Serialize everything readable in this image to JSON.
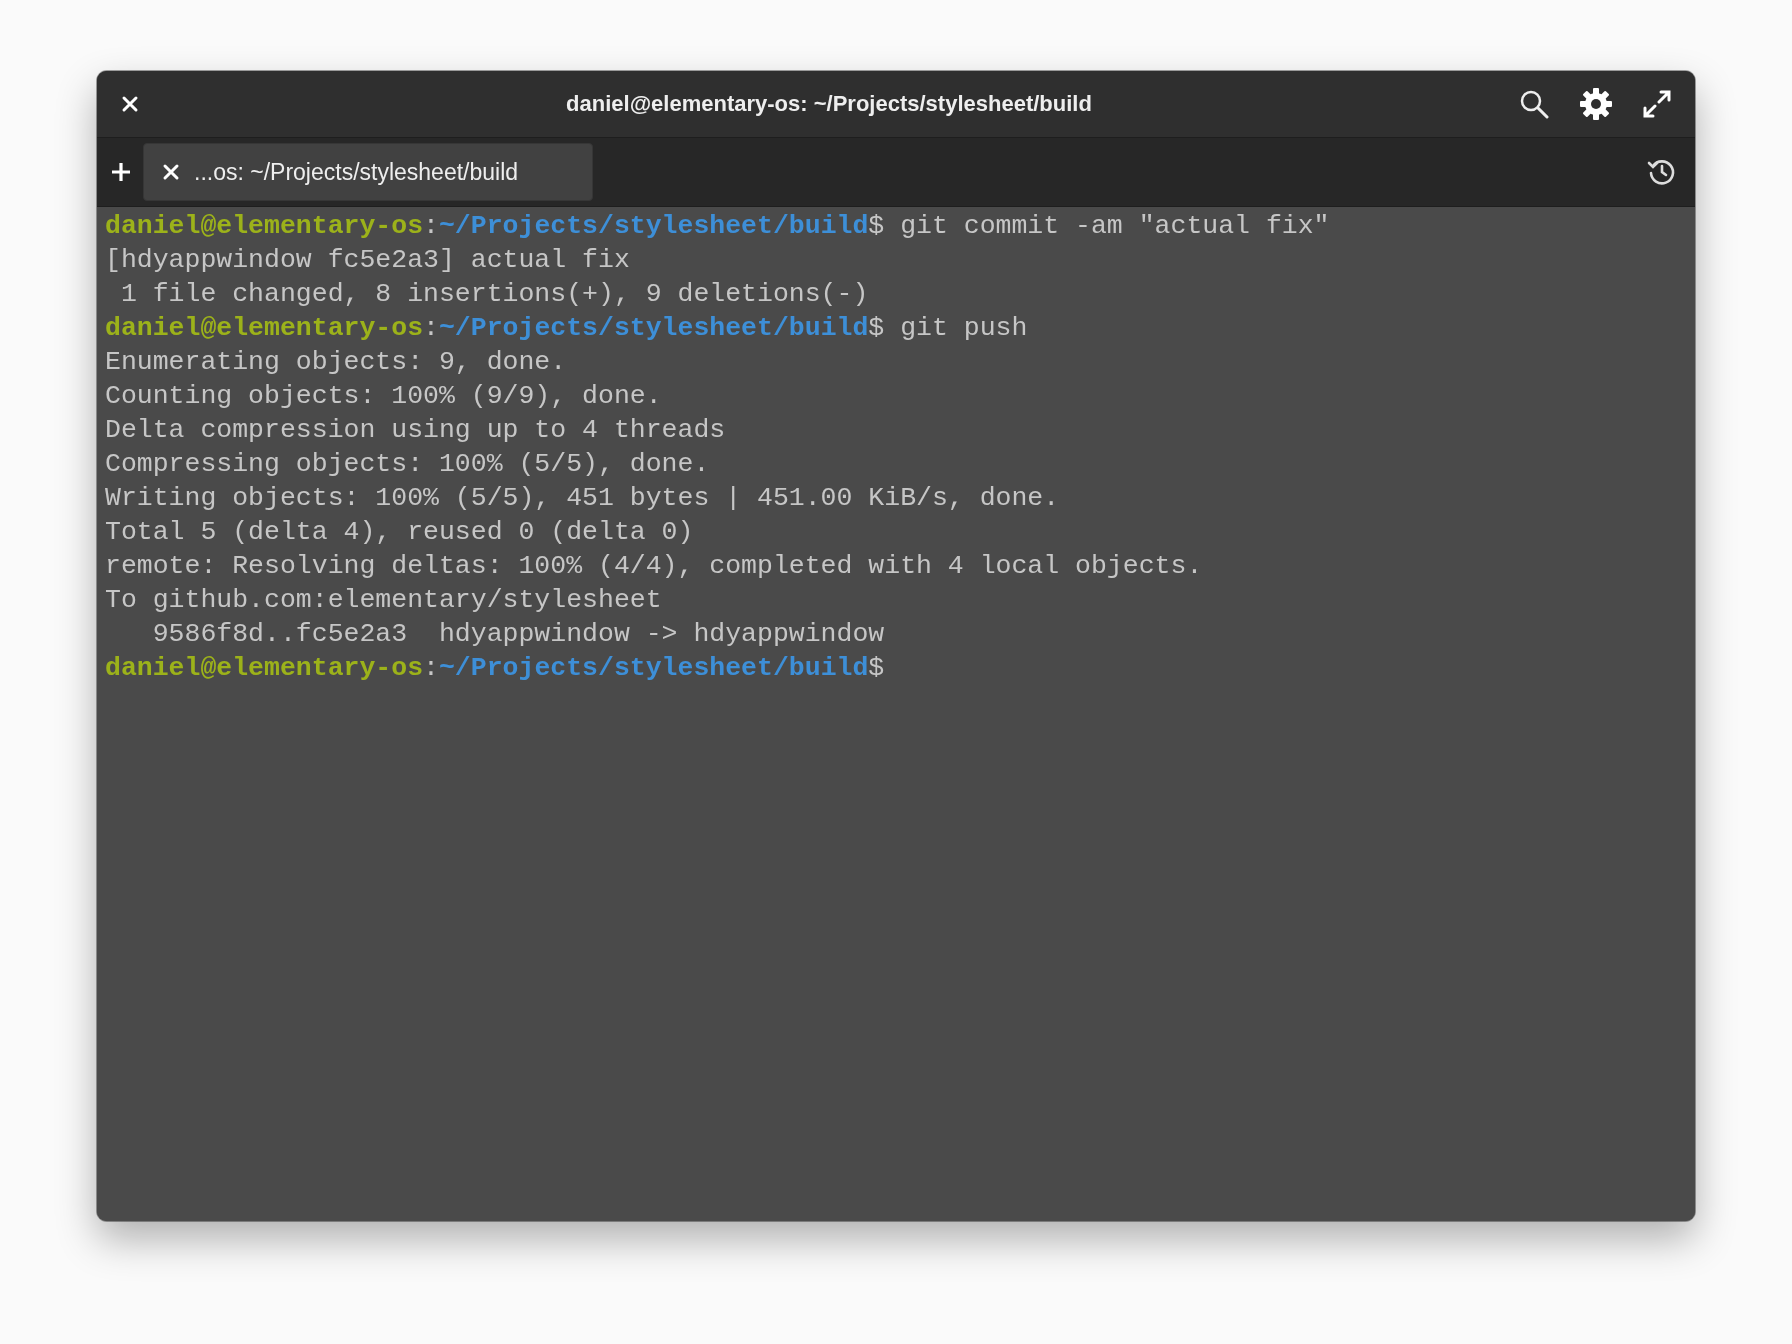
{
  "window": {
    "title": "daniel@elementary-os: ~/Projects/stylesheet/build"
  },
  "tabs": [
    {
      "label": "...os: ~/Projects/stylesheet/build",
      "selected": true
    }
  ],
  "terminal": {
    "lines": [
      {
        "kind": "prompt",
        "user": "daniel@elementary-os",
        "separator": ":",
        "path": "~/Projects/stylesheet/build",
        "symbol": "$",
        "command": "git commit -am \"actual fix\""
      },
      {
        "kind": "output",
        "text": "[hdyappwindow fc5e2a3] actual fix"
      },
      {
        "kind": "output",
        "text": " 1 file changed, 8 insertions(+), 9 deletions(-)"
      },
      {
        "kind": "prompt",
        "user": "daniel@elementary-os",
        "separator": ":",
        "path": "~/Projects/stylesheet/build",
        "symbol": "$",
        "command": "git push"
      },
      {
        "kind": "output",
        "text": "Enumerating objects: 9, done."
      },
      {
        "kind": "output",
        "text": "Counting objects: 100% (9/9), done."
      },
      {
        "kind": "output",
        "text": "Delta compression using up to 4 threads"
      },
      {
        "kind": "output",
        "text": "Compressing objects: 100% (5/5), done."
      },
      {
        "kind": "output",
        "text": "Writing objects: 100% (5/5), 451 bytes | 451.00 KiB/s, done."
      },
      {
        "kind": "output",
        "text": "Total 5 (delta 4), reused 0 (delta 0)"
      },
      {
        "kind": "output",
        "text": "remote: Resolving deltas: 100% (4/4), completed with 4 local objects."
      },
      {
        "kind": "output",
        "text": "To github.com:elementary/stylesheet"
      },
      {
        "kind": "output",
        "text": "   9586f8d..fc5e2a3  hdyappwindow -> hdyappwindow"
      },
      {
        "kind": "prompt",
        "user": "daniel@elementary-os",
        "separator": ":",
        "path": "~/Projects/stylesheet/build",
        "symbol": "$"
      }
    ]
  }
}
